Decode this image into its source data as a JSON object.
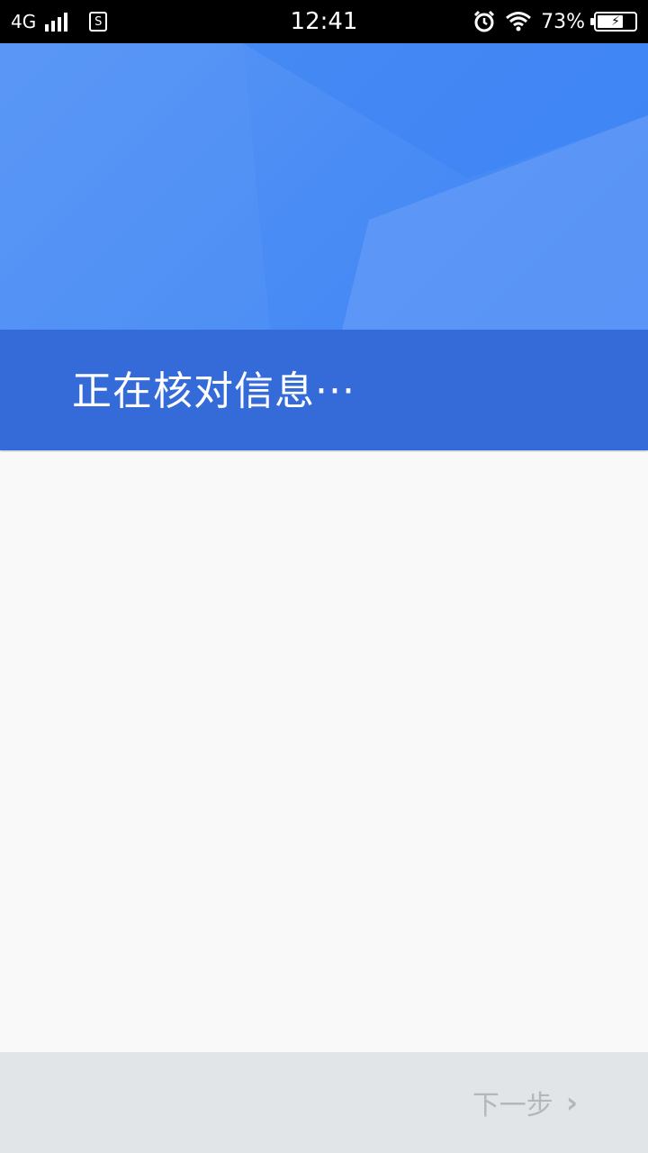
{
  "status_bar": {
    "network": "4G",
    "sim_label": "S",
    "time": "12:41",
    "battery_percent": "73%",
    "battery_level": 0.73,
    "icons": [
      "signal-icon",
      "sim-icon",
      "alarm-icon",
      "wifi-icon",
      "battery-icon"
    ]
  },
  "header": {
    "title": "正在核对信息···"
  },
  "footer": {
    "next_label": "下一步",
    "next_icon": "chevron-right-icon"
  },
  "colors": {
    "hero": "#4a8cf5",
    "banner": "#346bd8",
    "footer": "#e2e5e8",
    "next_text": "#b4b7ba"
  }
}
